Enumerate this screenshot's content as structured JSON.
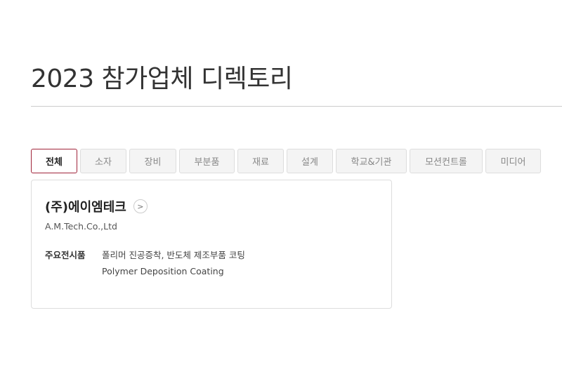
{
  "page": {
    "title": "2023 참가업체 디렉토리"
  },
  "tabs": [
    {
      "label": "전체",
      "active": true
    },
    {
      "label": "소자",
      "active": false
    },
    {
      "label": "장비",
      "active": false
    },
    {
      "label": "부분품",
      "active": false
    },
    {
      "label": "재료",
      "active": false
    },
    {
      "label": "설계",
      "active": false
    },
    {
      "label": "학교&기관",
      "active": false
    },
    {
      "label": "모션컨트롤",
      "active": false
    },
    {
      "label": "미디어",
      "active": false
    }
  ],
  "card": {
    "company_name": "(주)에이엠테크",
    "detail_icon": ">",
    "company_name_en": "A.M.Tech.Co.,Ltd",
    "products_label": "주요전시품",
    "products_ko": "폴리머 진공증착, 반도체 제조부품 코팅",
    "products_en": "Polymer Deposition Coating"
  },
  "colors": {
    "accent": "#a0243a",
    "border": "#dddddd",
    "tab_bg": "#f4f4f4"
  }
}
